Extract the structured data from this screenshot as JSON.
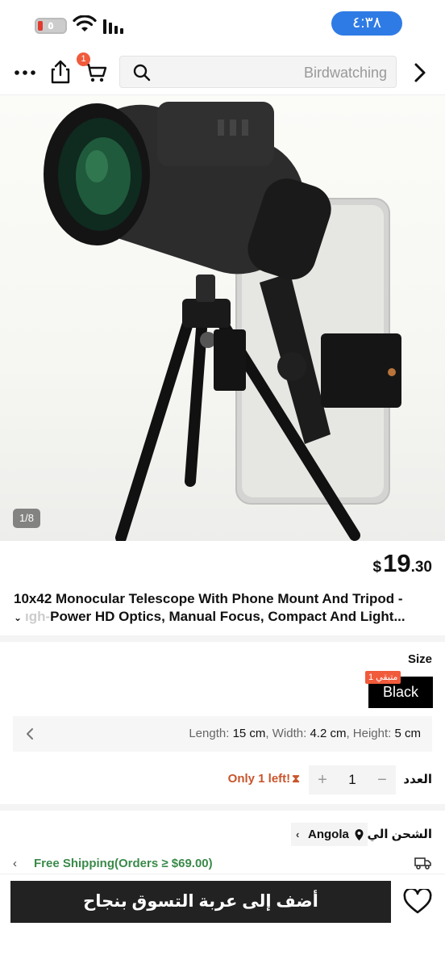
{
  "status_bar": {
    "battery": "٥",
    "time": "٤:٣٨"
  },
  "nav": {
    "cart_count": "1",
    "search_placeholder": "Birdwatching"
  },
  "gallery": {
    "counter": "1/8"
  },
  "product": {
    "price_currency": "$",
    "price_int": "19",
    "price_dec": ".30",
    "title_line1": "10x42 Monocular Telescope With Phone Mount And Tripod -",
    "title_line2_faded": "ıgh-",
    "title_line2": "Power HD Optics, Manual Focus, Compact And Light..."
  },
  "size": {
    "label": "Size",
    "selected": "Black",
    "stock_tag": "متبقي 1",
    "dims": {
      "length_label": "Length: ",
      "length": "15 cm",
      "width_label": ", Width: ",
      "width": "4.2 cm",
      "height_label": ", Height: ",
      "height": "5 cm"
    }
  },
  "quantity": {
    "label": "العدد",
    "value": "1",
    "plus": "+",
    "minus": "−",
    "only_left": "Only 1 left!",
    "hourglass": "⧗"
  },
  "shipping": {
    "label": "الشحن الي",
    "country": "Angola",
    "free_shipping": "Free Shipping(Orders ≥ $69.00)"
  },
  "bottom": {
    "add_to_cart": "أضف إلى عربة التسوق بنجاح"
  },
  "colors": {
    "accent_blue": "#2f7be5",
    "badge_orange": "#f05b3c",
    "stock_warning": "#c9552c",
    "free_shipping_green": "#3a8a4a",
    "button_dark": "#222222"
  },
  "icons": [
    "more-icon",
    "share-icon",
    "cart-icon",
    "search-icon",
    "forward-chevron-icon",
    "back-chevron-icon",
    "hourglass-icon",
    "location-pin-icon",
    "truck-icon",
    "heart-icon",
    "wifi-icon",
    "signal-icon",
    "battery-icon"
  ]
}
